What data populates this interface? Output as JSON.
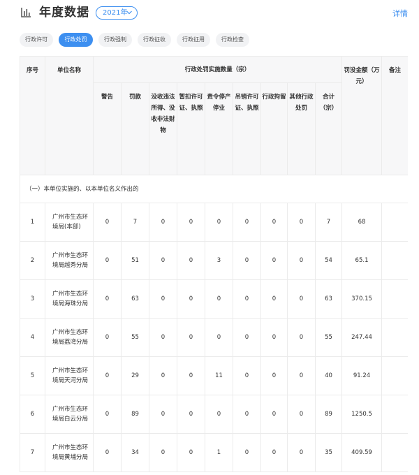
{
  "header": {
    "title": "年度数据",
    "year_select": "2021年",
    "detail_link": "详情"
  },
  "tabs": [
    "行政许可",
    "行政处罚",
    "行政强制",
    "行政征收",
    "行政征用",
    "行政检查"
  ],
  "active_tab": "行政处罚",
  "table": {
    "headers": {
      "index": "序号",
      "unit": "单位名称",
      "penalty_group": "行政处罚实施数量（宗）",
      "amount": "罚没金额（万元）",
      "remark": "备注"
    },
    "sub_headers": [
      "警告",
      "罚款",
      "没收违法所得、没收非法财物",
      "暂扣许可证、执照",
      "责令停产停业",
      "吊销许可证、执照",
      "行政拘留",
      "其他行政处罚",
      "合计（宗）"
    ],
    "section_label": "（一）本单位实施的、以本单位名义作出的",
    "rows": [
      {
        "index": "1",
        "unit": "广州市生态环境局(本部)",
        "warning": "0",
        "fine": "7",
        "confiscate": "0",
        "suspend_license": "0",
        "stop_business": "0",
        "revoke_license": "0",
        "detention": "0",
        "other": "0",
        "total": "7",
        "amount": "68",
        "remark": ""
      },
      {
        "index": "2",
        "unit": "广州市生态环境局越秀分局",
        "warning": "0",
        "fine": "51",
        "confiscate": "0",
        "suspend_license": "0",
        "stop_business": "3",
        "revoke_license": "0",
        "detention": "0",
        "other": "0",
        "total": "54",
        "amount": "65.1",
        "remark": ""
      },
      {
        "index": "3",
        "unit": "广州市生态环境局海珠分局",
        "warning": "0",
        "fine": "63",
        "confiscate": "0",
        "suspend_license": "0",
        "stop_business": "0",
        "revoke_license": "0",
        "detention": "0",
        "other": "0",
        "total": "63",
        "amount": "370.15",
        "remark": ""
      },
      {
        "index": "4",
        "unit": "广州市生态环境局荔湾分局",
        "warning": "0",
        "fine": "55",
        "confiscate": "0",
        "suspend_license": "0",
        "stop_business": "0",
        "revoke_license": "0",
        "detention": "0",
        "other": "0",
        "total": "55",
        "amount": "247.44",
        "remark": ""
      },
      {
        "index": "5",
        "unit": "广州市生态环境局天河分局",
        "warning": "0",
        "fine": "29",
        "confiscate": "0",
        "suspend_license": "0",
        "stop_business": "11",
        "revoke_license": "0",
        "detention": "0",
        "other": "0",
        "total": "40",
        "amount": "91.24",
        "remark": ""
      },
      {
        "index": "6",
        "unit": "广州市生态环境局白云分局",
        "warning": "0",
        "fine": "89",
        "confiscate": "0",
        "suspend_license": "0",
        "stop_business": "0",
        "revoke_license": "0",
        "detention": "0",
        "other": "0",
        "total": "89",
        "amount": "1250.5",
        "remark": ""
      },
      {
        "index": "7",
        "unit": "广州市生态环境局黄埔分局",
        "warning": "0",
        "fine": "34",
        "confiscate": "0",
        "suspend_license": "0",
        "stop_business": "1",
        "revoke_license": "0",
        "detention": "0",
        "other": "0",
        "total": "35",
        "amount": "409.59",
        "remark": ""
      }
    ]
  },
  "colors": {
    "accent": "#3d8ff0",
    "tab_bg": "#f1f2f4",
    "header_bg": "#f7f7f8",
    "border": "#ebebeb"
  },
  "icons": {
    "title_icon": "bar-chart-icon",
    "year_icon": "chevron-down-icon"
  }
}
